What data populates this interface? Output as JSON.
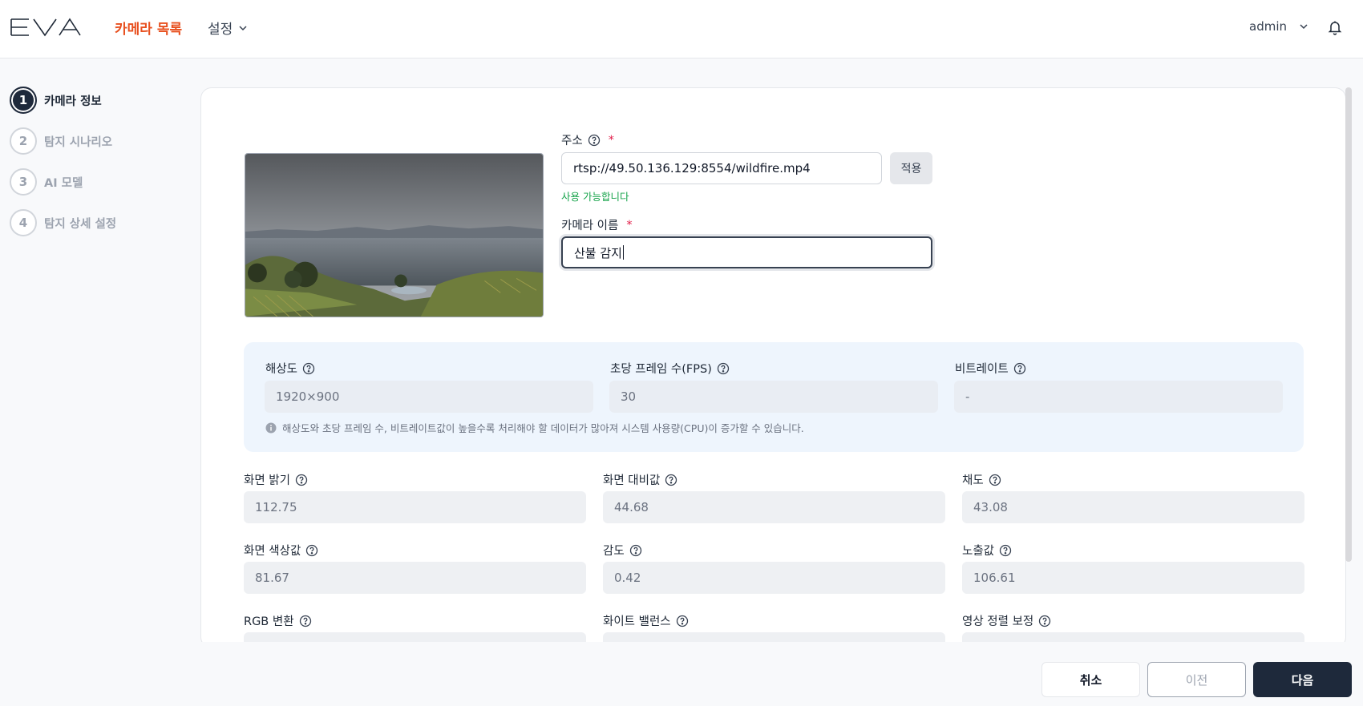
{
  "header": {
    "logo_text": "EVA",
    "nav_camera_list": "카메라 목록",
    "nav_settings": "설정",
    "user": "admin",
    "accent_color": "#e8501f"
  },
  "steps": [
    {
      "num": "1",
      "label": "카메라 정보",
      "active": true
    },
    {
      "num": "2",
      "label": "탐지 시나리오",
      "active": false
    },
    {
      "num": "3",
      "label": "AI 모델",
      "active": false
    },
    {
      "num": "4",
      "label": "탐지 상세 설정",
      "active": false
    }
  ],
  "form": {
    "address_label": "주소",
    "address_value": "rtsp://49.50.136.129:8554/wildfire.mp4",
    "apply_label": "적용",
    "address_status": "사용 가능합니다",
    "name_label": "카메라 이름",
    "name_value": "산불 감지",
    "required_mark": "*"
  },
  "stream_info": {
    "resolution_label": "해상도",
    "resolution_value": "1920×900",
    "fps_label": "초당 프레임 수(FPS)",
    "fps_value": "30",
    "bitrate_label": "비트레이트",
    "bitrate_value": "-",
    "note": "해상도와 초당 프레임 수, 비트레이트값이 높을수록 처리해야 할 데이터가 많아져 시스템 사용량(CPU)이 증가할 수 있습니다."
  },
  "image_params": {
    "brightness_label": "화면 밝기",
    "brightness_value": "112.75",
    "contrast_label": "화면 대비값",
    "contrast_value": "44.68",
    "saturation_label": "채도",
    "saturation_value": "43.08",
    "hue_label": "화면 색상값",
    "hue_value": "81.67",
    "gain_label": "감도",
    "gain_value": "0.42",
    "exposure_label": "노출값",
    "exposure_value": "106.61",
    "rgb_label": "RGB 변환",
    "white_balance_label": "화이트 밸런스",
    "alignment_label": "영상 정렬 보정"
  },
  "footer": {
    "cancel": "취소",
    "prev": "이전",
    "next": "다음"
  }
}
